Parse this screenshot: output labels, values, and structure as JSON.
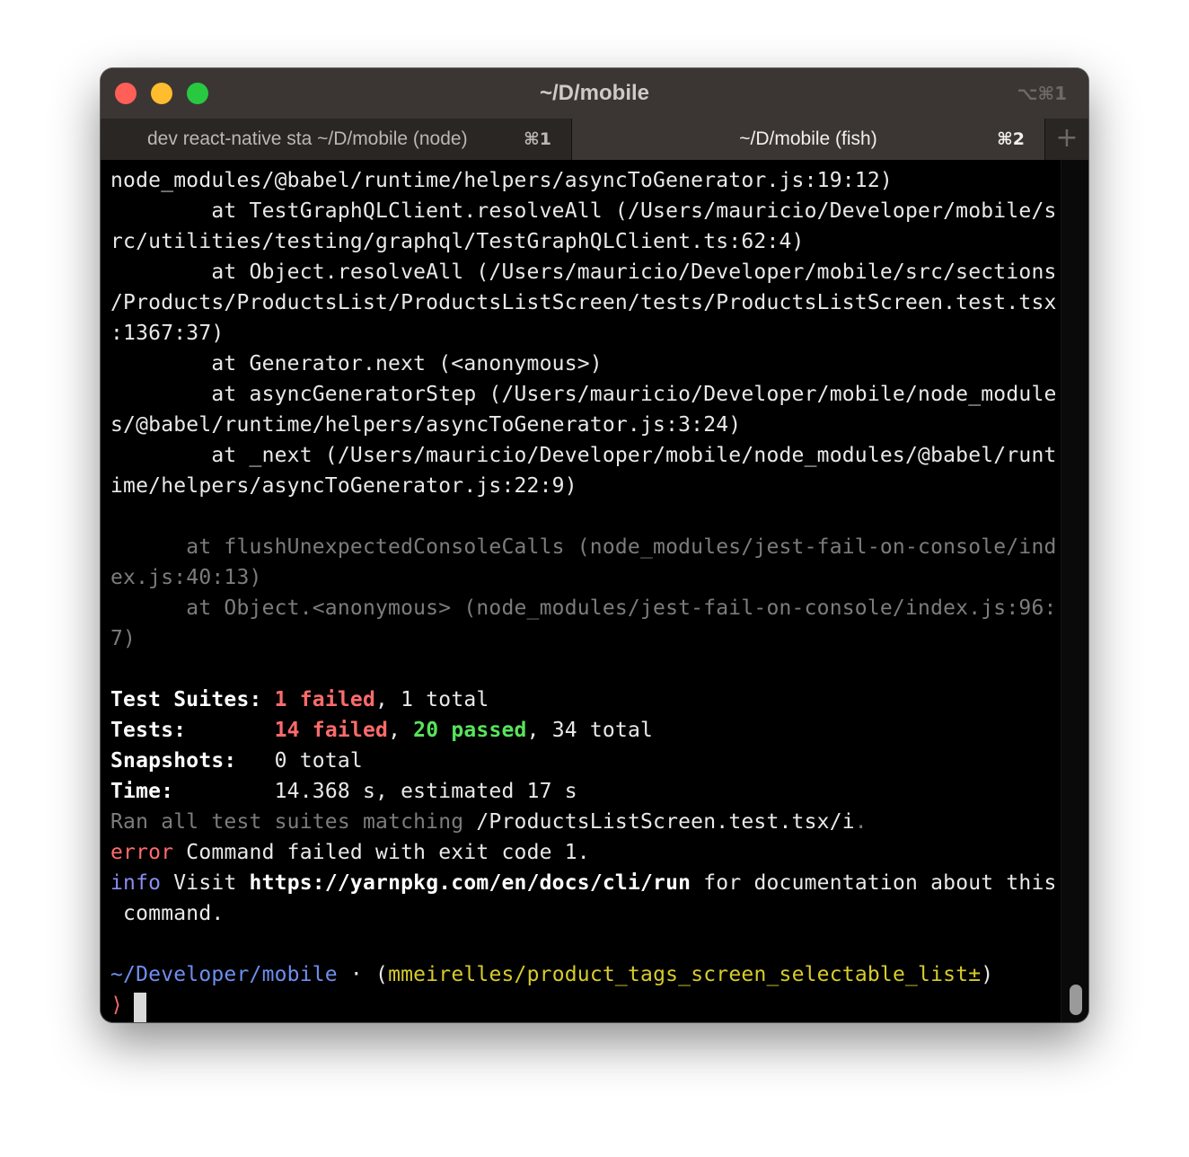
{
  "window": {
    "title": "~/D/mobile",
    "title_shortcut": "⌥⌘1"
  },
  "tabs": [
    {
      "label": "dev react-native sta ~/D/mobile (node)",
      "shortcut": "⌘1",
      "active": false
    },
    {
      "label": "~/D/mobile (fish)",
      "shortcut": "⌘2",
      "active": true
    }
  ],
  "new_tab_label": "+",
  "terminal": {
    "stack": [
      "node_modules/@babel/runtime/helpers/asyncToGenerator.js:19:12)",
      "        at TestGraphQLClient.resolveAll (/Users/mauricio/Developer/mobile/s",
      "rc/utilities/testing/graphql/TestGraphQLClient.ts:62:4)",
      "        at Object.resolveAll (/Users/mauricio/Developer/mobile/src/sections",
      "/Products/ProductsList/ProductsListScreen/tests/ProductsListScreen.test.tsx",
      ":1367:37)",
      "        at Generator.next (<anonymous>)",
      "        at asyncGeneratorStep (/Users/mauricio/Developer/mobile/node_module",
      "s/@babel/runtime/helpers/asyncToGenerator.js:3:24)",
      "        at _next (/Users/mauricio/Developer/mobile/node_modules/@babel/runt",
      "ime/helpers/asyncToGenerator.js:22:9)"
    ],
    "console_trace": [
      "      at flushUnexpectedConsoleCalls (node_modules/jest-fail-on-console/ind",
      "ex.js:40:13)",
      "      at Object.<anonymous> (node_modules/jest-fail-on-console/index.js:96:",
      "7)"
    ],
    "summary": {
      "suites": {
        "label": "Test Suites: ",
        "failed": "1 failed",
        "sep": ", ",
        "total": "1 total"
      },
      "tests": {
        "label": "Tests:       ",
        "failed": "14 failed",
        "sep1": ", ",
        "passed": "20 passed",
        "sep2": ", ",
        "total": "34 total"
      },
      "snapshots": {
        "label": "Snapshots:   ",
        "total": "0 total"
      },
      "time": {
        "label": "Time:        ",
        "value": "14.368 s, estimated 17 s"
      },
      "ran": {
        "prefix": "Ran all test suites matching ",
        "pattern": "/ProductsListScreen.test.tsx/i",
        "suffix": "."
      }
    },
    "error": {
      "tag": "error",
      "message": " Command failed with exit code 1."
    },
    "info": {
      "tag": "info",
      "pre": " Visit ",
      "url": "https://yarnpkg.com/en/docs/cli/run",
      "post": " for documentation about this",
      "cont": " command."
    },
    "prompt": {
      "path": "~/Developer/mobile",
      "sep": " · ",
      "branch_open": "(",
      "branch": "mmeirelles/product_tags_screen_selectable_list±",
      "branch_close": ")",
      "symbol": "⟩"
    }
  },
  "colors": {
    "titlebar": "#3b3634",
    "tabbar": "#2a2624",
    "failed": "#ff6b6b",
    "passed": "#57e45b",
    "info": "#8a8cf0",
    "path": "#6f8ef0",
    "branch": "#d7cc2a"
  }
}
